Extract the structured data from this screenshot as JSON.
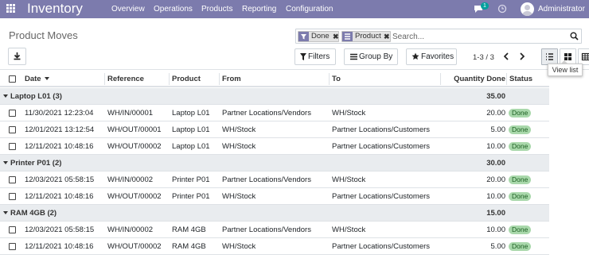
{
  "navbar": {
    "brand": "Inventory",
    "menu": [
      "Overview",
      "Operations",
      "Products",
      "Reporting",
      "Configuration"
    ],
    "chat_count": "1",
    "user": "Administrator"
  },
  "control": {
    "title": "Product Moves",
    "search": {
      "facets": [
        {
          "label": "Done",
          "icon": "filter-icon"
        },
        {
          "label": "Product",
          "icon": "group-by-icon"
        }
      ],
      "placeholder": "Search..."
    },
    "buttons": {
      "filters": "Filters",
      "group_by": "Group By",
      "favorites": "Favorites"
    },
    "pager": "1-3 / 3",
    "tooltip": "View list"
  },
  "table": {
    "headers": {
      "date": "Date",
      "reference": "Reference",
      "product": "Product",
      "from": "From",
      "to": "To",
      "qty": "Quantity Done",
      "status": "Status"
    },
    "groups": [
      {
        "label": "Laptop L01 (3)",
        "total": "35.00",
        "rows": [
          {
            "date": "11/30/2021 12:23:04",
            "reference": "WH/IN/00001",
            "product": "Laptop L01",
            "from": "Partner Locations/Vendors",
            "to": "WH/Stock",
            "qty": "20.00",
            "status": "Done"
          },
          {
            "date": "12/01/2021 13:12:54",
            "reference": "WH/OUT/00001",
            "product": "Laptop L01",
            "from": "WH/Stock",
            "to": "Partner Locations/Customers",
            "qty": "5.00",
            "status": "Done"
          },
          {
            "date": "12/11/2021 10:48:16",
            "reference": "WH/OUT/00002",
            "product": "Laptop L01",
            "from": "WH/Stock",
            "to": "Partner Locations/Customers",
            "qty": "10.00",
            "status": "Done"
          }
        ]
      },
      {
        "label": "Printer P01 (2)",
        "total": "30.00",
        "rows": [
          {
            "date": "12/03/2021 05:58:15",
            "reference": "WH/IN/00002",
            "product": "Printer P01",
            "from": "Partner Locations/Vendors",
            "to": "WH/Stock",
            "qty": "20.00",
            "status": "Done"
          },
          {
            "date": "12/11/2021 10:48:16",
            "reference": "WH/OUT/00002",
            "product": "Printer P01",
            "from": "WH/Stock",
            "to": "Partner Locations/Customers",
            "qty": "10.00",
            "status": "Done"
          }
        ]
      },
      {
        "label": "RAM 4GB (2)",
        "total": "15.00",
        "rows": [
          {
            "date": "12/03/2021 05:58:15",
            "reference": "WH/IN/00002",
            "product": "RAM 4GB",
            "from": "Partner Locations/Vendors",
            "to": "WH/Stock",
            "qty": "10.00",
            "status": "Done"
          },
          {
            "date": "12/11/2021 10:48:16",
            "reference": "WH/OUT/00002",
            "product": "RAM 4GB",
            "from": "WH/Stock",
            "to": "Partner Locations/Customers",
            "qty": "5.00",
            "status": "Done"
          }
        ]
      }
    ]
  }
}
